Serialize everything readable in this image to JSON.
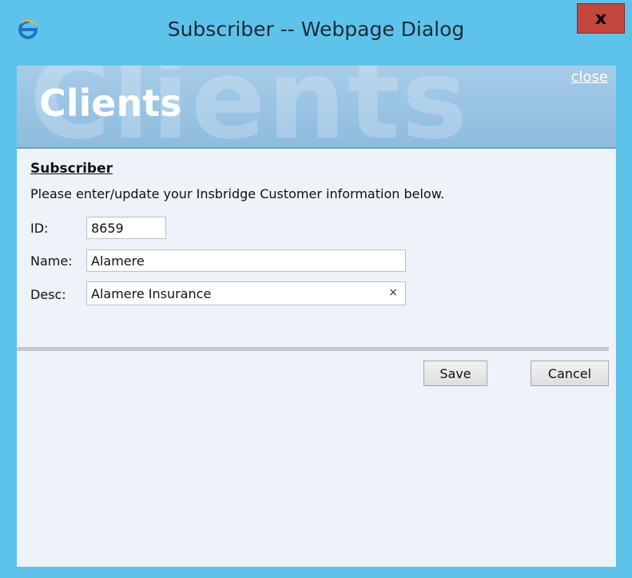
{
  "window": {
    "title": "Subscriber -- Webpage Dialog",
    "close_glyph": "x",
    "app_icon": "internet-explorer-icon"
  },
  "banner": {
    "watermark": "Clients",
    "title": "Clients",
    "close_link": "close"
  },
  "form": {
    "heading": "Subscriber",
    "instructions": "Please enter/update your Insbridge Customer information below.",
    "id_label": "ID:",
    "id_value": "8659",
    "name_label": "Name:",
    "name_value": "Alamere",
    "desc_label": "Desc:",
    "desc_value": "Alamere Insurance",
    "clear_glyph": "×"
  },
  "buttons": {
    "save": "Save",
    "cancel": "Cancel"
  },
  "colors": {
    "frame": "#5ec3ea",
    "close_button": "#c4453c",
    "banner": "#a6cce8",
    "content_bg": "#edf3f9"
  }
}
